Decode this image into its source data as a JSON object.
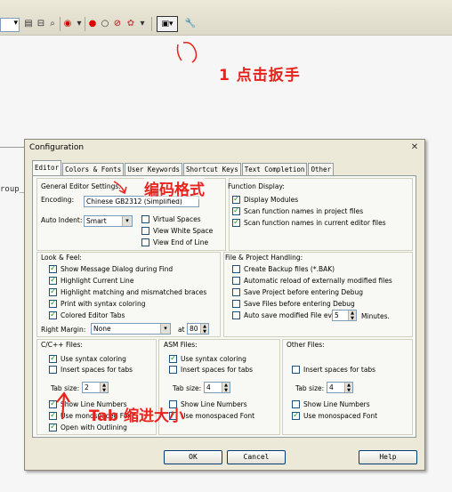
{
  "annotations": {
    "wrench_hint": "1 点击扳手",
    "encoding_hint": "编码格式",
    "tab_hint": "Tab 缩进大小"
  },
  "background": {
    "partial_text": "roup_"
  },
  "dialog": {
    "title": "Configuration",
    "tabs": [
      "Editor",
      "Colors & Fonts",
      "User Keywords",
      "Shortcut Keys",
      "Text Completion",
      "Other"
    ],
    "editor_settings": {
      "label": "General Editor Settings:",
      "encoding_label": "Encoding:",
      "encoding_value": "Chinese GB2312 (Simplified)",
      "auto_indent_label": "Auto Indent:",
      "auto_indent_value": "Smart",
      "virtual_spaces": "Virtual Spaces",
      "view_white_space": "View White Space",
      "view_end_of_line": "View End of Line"
    },
    "function_display": {
      "label": "Function Display:",
      "items": [
        "Display Modules",
        "Scan function names in project files",
        "Scan function names in current editor files"
      ]
    },
    "look_feel": {
      "label": "Look & Feel:",
      "items": [
        "Show Message Dialog during Find",
        "Highlight Current Line",
        "Highlight matching and mismatched braces",
        "Print with syntax coloring",
        "Colored Editor Tabs"
      ],
      "right_margin_label": "Right Margin:",
      "right_margin_value": "None",
      "at_label": "at",
      "at_value": "80"
    },
    "file_project": {
      "label": "File & Project Handling:",
      "items": [
        "Create Backup files (*.BAK)",
        "Automatic reload of externally modified files",
        "Save Project before entering Debug",
        "Save Files before entering Debug",
        "Auto save modified File every"
      ],
      "minutes_value": "5",
      "minutes_label": "Minutes."
    },
    "cpp": {
      "label": "C/C++ Files:",
      "syntax": "Use syntax coloring",
      "insert_spaces": "Insert spaces for tabs",
      "tab_size_label": "Tab size:",
      "tab_size_value": "2",
      "line_numbers": "Show Line Numbers",
      "monospaced": "Use monospaced Font",
      "outlining": "Open with Outlining"
    },
    "asm": {
      "label": "ASM Files:",
      "syntax": "Use syntax coloring",
      "insert_spaces": "Insert spaces for tabs",
      "tab_size_label": "Tab size:",
      "tab_size_value": "4",
      "line_numbers": "Show Line Numbers",
      "monospaced": "Use monospaced Font"
    },
    "other": {
      "label": "Other Files:",
      "insert_spaces": "Insert spaces for tabs",
      "tab_size_label": "Tab size:",
      "tab_size_value": "4",
      "line_numbers": "Show Line Numbers",
      "monospaced": "Use monospaced Font"
    },
    "buttons": {
      "ok": "OK",
      "cancel": "Cancel",
      "help": "Help"
    }
  }
}
